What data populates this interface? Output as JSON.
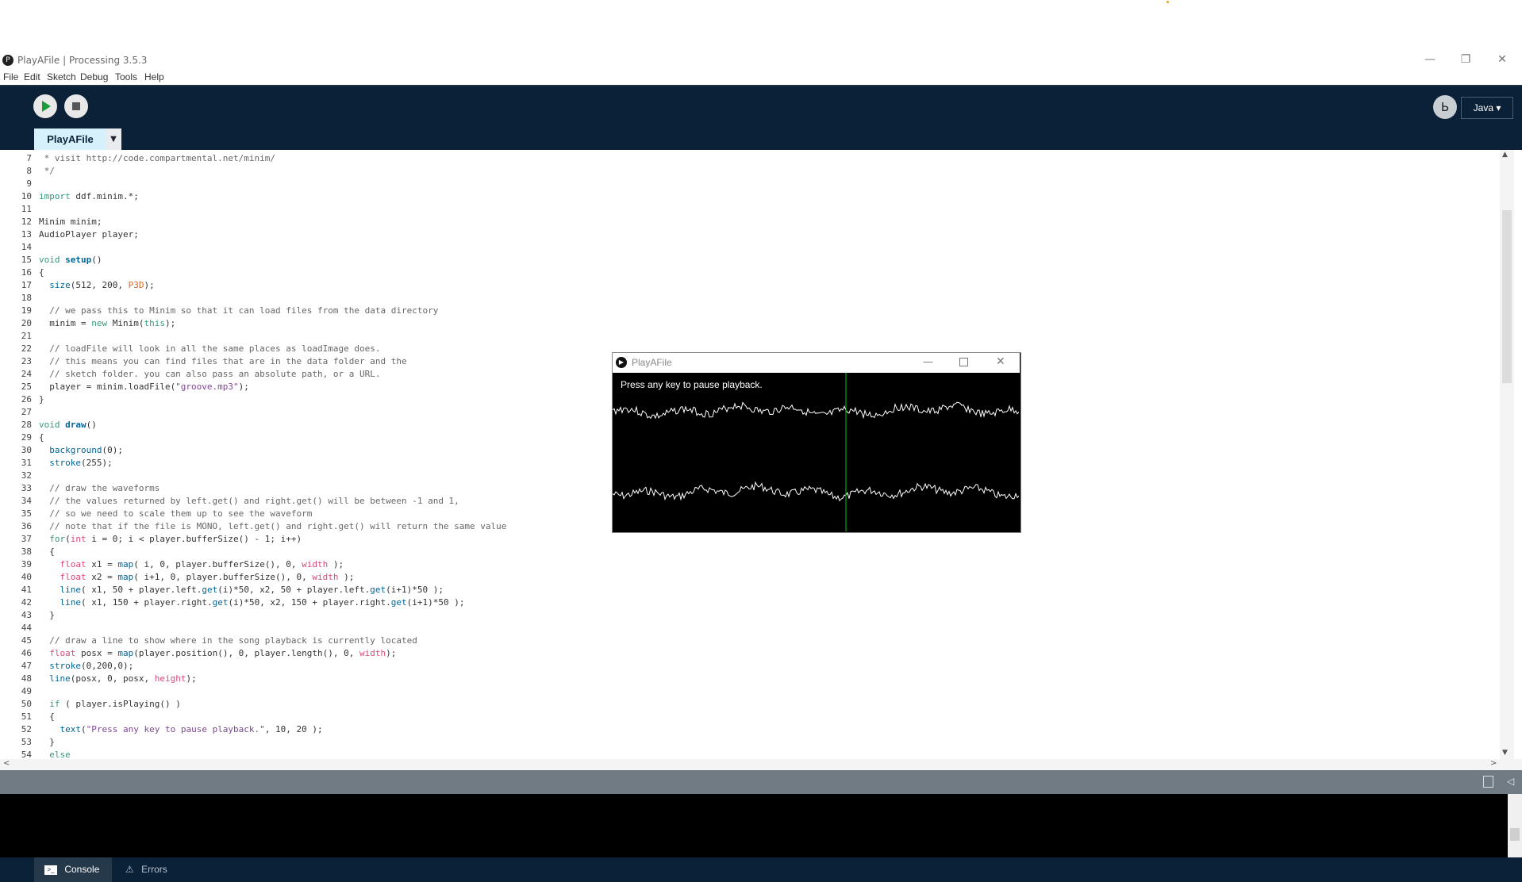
{
  "window": {
    "title": "PlayAFile | Processing 3.5.3"
  },
  "menu": [
    "File",
    "Edit",
    "Sketch",
    "Debug",
    "Tools",
    "Help"
  ],
  "toolbar": {
    "mode": "Java ▾"
  },
  "tabs": [
    {
      "label": "PlayAFile"
    }
  ],
  "editor": {
    "lines": [
      {
        "n": "7",
        "html": " * visit http://code.compartmental.net/minim/",
        "cls": "cmt"
      },
      {
        "n": "8",
        "html": " */",
        "cls": "cmt"
      },
      {
        "n": "9",
        "html": ""
      },
      {
        "n": "10",
        "html": "<span class='kw'>import</span> ddf.minim.*;"
      },
      {
        "n": "11",
        "html": ""
      },
      {
        "n": "12",
        "html": "Minim minim;"
      },
      {
        "n": "13",
        "html": "AudioPlayer player;"
      },
      {
        "n": "14",
        "html": ""
      },
      {
        "n": "15",
        "html": "<span class='kw'>void</span> <span class='fn'>setup</span>()"
      },
      {
        "n": "16",
        "html": "{"
      },
      {
        "n": "17",
        "html": "  <span class='blu'>size</span>(512, 200, <span class='org'>P3D</span>);"
      },
      {
        "n": "18",
        "html": ""
      },
      {
        "n": "19",
        "html": "  // we pass this to Minim so that it can load files from the data directory",
        "cls": "cmt"
      },
      {
        "n": "20",
        "html": "  minim = <span class='kw'>new</span> Minim(<span class='kw'>this</span>);"
      },
      {
        "n": "21",
        "html": ""
      },
      {
        "n": "22",
        "html": "  // loadFile will look in all the same places as loadImage does.",
        "cls": "cmt"
      },
      {
        "n": "23",
        "html": "  // this means you can find files that are in the data folder and the",
        "cls": "cmt"
      },
      {
        "n": "24",
        "html": "  // sketch folder. you can also pass an absolute path, or a URL.",
        "cls": "cmt"
      },
      {
        "n": "25",
        "html": "  player = minim.loadFile(<span class='str'>\"groove.mp3\"</span>);"
      },
      {
        "n": "26",
        "html": "}"
      },
      {
        "n": "27",
        "html": ""
      },
      {
        "n": "28",
        "html": "<span class='kw'>void</span> <span class='fn'>draw</span>()"
      },
      {
        "n": "29",
        "html": "{"
      },
      {
        "n": "30",
        "html": "  <span class='blu'>background</span>(0);"
      },
      {
        "n": "31",
        "html": "  <span class='blu'>stroke</span>(255);"
      },
      {
        "n": "32",
        "html": ""
      },
      {
        "n": "33",
        "html": "  // draw the waveforms",
        "cls": "cmt"
      },
      {
        "n": "34",
        "html": "  // the values returned by left.get() and right.get() will be between -1 and 1,",
        "cls": "cmt"
      },
      {
        "n": "35",
        "html": "  // so we need to scale them up to see the waveform",
        "cls": "cmt"
      },
      {
        "n": "36",
        "html": "  // note that if the file is MONO, left.get() and right.get() will return the same value",
        "cls": "cmt"
      },
      {
        "n": "37",
        "html": "  <span class='kw'>for</span>(<span class='pink'>int</span> i = 0; i &lt; player.bufferSize() - 1; i++)"
      },
      {
        "n": "38",
        "html": "  {"
      },
      {
        "n": "39",
        "html": "    <span class='pink'>float</span> x1 = <span class='blu'>map</span>( i, 0, player.bufferSize(), 0, <span class='pink'>width</span> );"
      },
      {
        "n": "40",
        "html": "    <span class='pink'>float</span> x2 = <span class='blu'>map</span>( i+1, 0, player.bufferSize(), 0, <span class='pink'>width</span> );"
      },
      {
        "n": "41",
        "html": "    <span class='blu'>line</span>( x1, 50 + player.left.<span class='blu'>get</span>(i)*50, x2, 50 + player.left.<span class='blu'>get</span>(i+1)*50 );"
      },
      {
        "n": "42",
        "html": "    <span class='blu'>line</span>( x1, 150 + player.right.<span class='blu'>get</span>(i)*50, x2, 150 + player.right.<span class='blu'>get</span>(i+1)*50 );"
      },
      {
        "n": "43",
        "html": "  }"
      },
      {
        "n": "44",
        "html": ""
      },
      {
        "n": "45",
        "html": "  // draw a line to show where in the song playback is currently located",
        "cls": "cmt"
      },
      {
        "n": "46",
        "html": "  <span class='pink'>float</span> posx = <span class='blu'>map</span>(player.position(), 0, player.length(), 0, <span class='pink'>width</span>);"
      },
      {
        "n": "47",
        "html": "  <span class='blu'>stroke</span>(0,200,0);"
      },
      {
        "n": "48",
        "html": "  <span class='blu'>line</span>(posx, 0, posx, <span class='pink'>height</span>);"
      },
      {
        "n": "49",
        "html": ""
      },
      {
        "n": "50",
        "html": "  <span class='kw'>if</span> ( player.isPlaying() )"
      },
      {
        "n": "51",
        "html": "  {"
      },
      {
        "n": "52",
        "html": "    <span class='blu'>text</span>(<span class='str'>\"Press any key to pause playback.\"</span>, 10, 20 );"
      },
      {
        "n": "53",
        "html": "  }"
      },
      {
        "n": "54",
        "html": "  <span class='kw'>else</span>"
      }
    ]
  },
  "console_tabs": {
    "console": "Console",
    "errors": "Errors"
  },
  "sketch_window": {
    "title": "PlayAFile",
    "text": "Press any key to pause playback."
  },
  "colors": {
    "toolbar_bg": "#0b2138",
    "tab_active": "#d6f1fb",
    "playhead": "#00c800"
  }
}
